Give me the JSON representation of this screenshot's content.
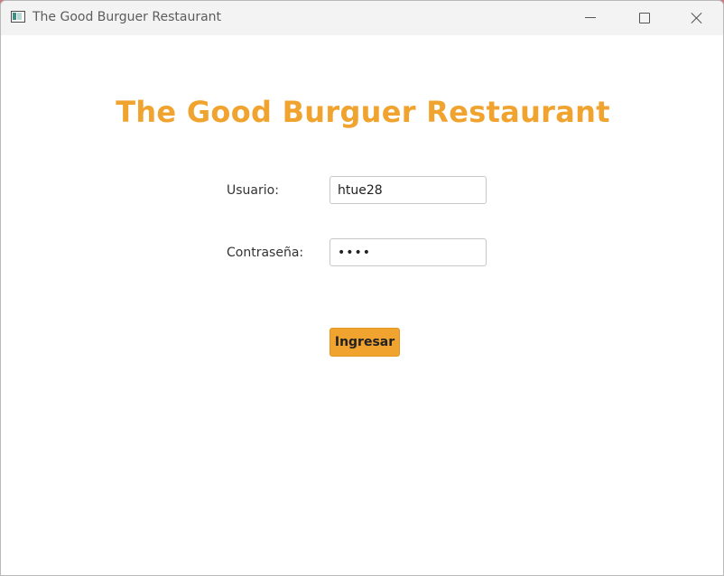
{
  "window": {
    "title": "The Good Burguer Restaurant"
  },
  "form": {
    "heading": "The Good Burguer Restaurant",
    "user_label": "Usuario:",
    "user_value": "htue28",
    "password_label": "Contraseña:",
    "password_value": "abcd",
    "submit_label": "Ingresar"
  },
  "icons": {
    "app": "app-window-icon",
    "minimize": "minimize-icon",
    "maximize": "maximize-icon",
    "close": "close-icon"
  },
  "colors": {
    "accent": "#f0a32f",
    "titlebar": "#f3f3f3"
  }
}
